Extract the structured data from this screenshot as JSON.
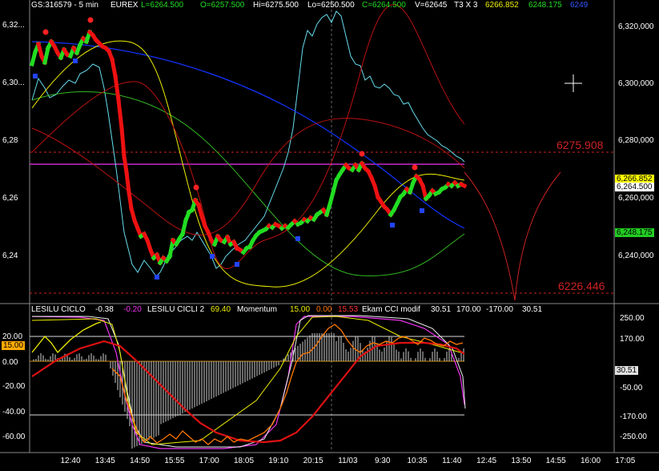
{
  "header": {
    "symbol": "GS:316579 - 5 min",
    "exchange": "EUREX",
    "last": "L=6264.500",
    "open": "O=6257.500",
    "high": "Hi=6275.500",
    "low": "Lo=6250.500",
    "close": "C=6264.500",
    "volume": "V=62645",
    "mode": "T3 X 3",
    "val1": "6266.852",
    "val2": "6248.175",
    "val3": "6249"
  },
  "indicator_header": {
    "name1": "LESILU CICLO",
    "v1a": "-0.38",
    "v1b": "-0.20",
    "name2": "LESILU CICLI 2",
    "v2": "69.40",
    "name3": "Momentum",
    "v3a": "15.00",
    "v3b": "0.00",
    "v3c": "15.53",
    "name4": "Ekam CCI modif",
    "v4a": "30.51",
    "v4b": "170.00",
    "v4c": "-170.00",
    "v4d": "30.51"
  },
  "main_axis": {
    "left_ticks": [
      "6,32...",
      "6,30...",
      "6,28",
      "6,26",
      "6,24"
    ],
    "right_ticks": [
      "6,320,000",
      "6,300,000",
      "6,280,000",
      "6,260,000",
      "6,240,000"
    ],
    "level_high_label": "6275.908",
    "level_low_label": "6226.446",
    "tag_yellow": "6,266.852",
    "tag_white": "6,264.500",
    "tag_green": "6,248.175"
  },
  "ind_axis": {
    "left_ticks": [
      "20.00",
      "0.00",
      "-20.00",
      "-40.00",
      "-60.00"
    ],
    "left_tag": "15.00",
    "right_ticks": [
      "250.00",
      "170.00",
      "-50.00",
      "-170.00",
      "-250.00"
    ],
    "right_tag": "30.51"
  },
  "time_axis": [
    "12:40",
    "13:45",
    "14:50",
    "15:55",
    "17:00",
    "18:05",
    "19:10",
    "20:15",
    "11/03",
    "9:30",
    "10:35",
    "11:40",
    "12:45",
    "13:50",
    "14:55",
    "16:00",
    "17:05"
  ],
  "colors": {
    "background": "#000000",
    "bull": "#22dd22",
    "bear": "#ee1111",
    "cyan": "#66ddee",
    "yellow": "#eeee00",
    "blue": "#1133ff",
    "green_line": "#33bb22",
    "dark_red": "#bb1111",
    "magenta": "#ee33ee",
    "orange": "#ff7700",
    "level_line": "#cc2222"
  },
  "chart_data": [
    {
      "type": "line",
      "title": "GS:316579 - 5 min",
      "x": [
        "12:40",
        "13:45",
        "14:50",
        "15:55",
        "17:00",
        "18:05",
        "19:10",
        "20:15",
        "11/03",
        "9:30",
        "10:35",
        "11:40"
      ],
      "series": [
        {
          "values": [
            6318,
            6315,
            6255,
            6238,
            6248,
            6244,
            6250,
            6254,
            6268,
            6258,
            6262,
            6265
          ]
        }
      ],
      "ylim": [
        6222,
        6335
      ],
      "levels": [
        6275.908,
        6226.446,
        6270.5
      ]
    },
    {
      "type": "line",
      "x": [
        "12:40",
        "13:45",
        "14:50",
        "15:55",
        "17:00",
        "18:05",
        "19:10",
        "20:15",
        "11/03",
        "9:30",
        "10:35",
        "11:40"
      ],
      "series": [
        {
          "values": [
            10,
            20,
            2,
            -60,
            -50,
            -40,
            -20,
            20,
            28,
            18,
            8,
            5
          ]
        }
      ],
      "ylim": [
        -70,
        30
      ],
      "levels": [
        15,
        0,
        -40
      ]
    }
  ]
}
